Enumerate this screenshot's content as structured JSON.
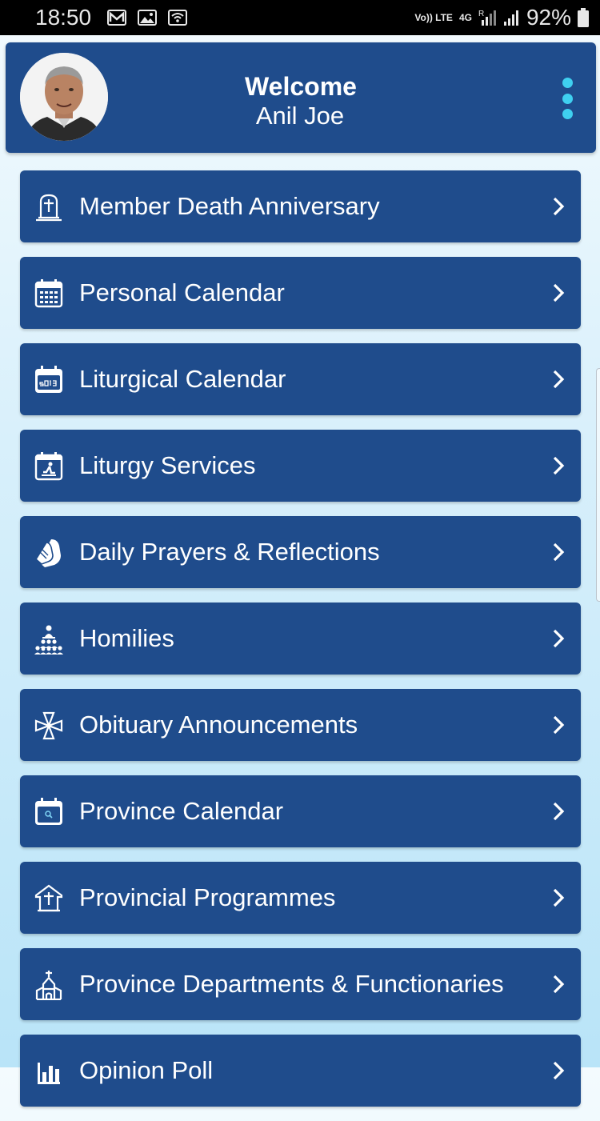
{
  "status_bar": {
    "time": "18:50",
    "battery": "92%",
    "volte_label": "Vo)) LTE",
    "network_label": "4G",
    "roaming_label": "R"
  },
  "header": {
    "welcome": "Welcome",
    "user_name": "Anil Joe",
    "avatar": "user-avatar"
  },
  "menu": {
    "items": [
      {
        "label": "Member Death Anniversary",
        "icon": "tombstone-cross-icon"
      },
      {
        "label": "Personal Calendar",
        "icon": "calendar-grid-icon"
      },
      {
        "label": "Liturgical Calendar",
        "icon": "calendar-2013-icon"
      },
      {
        "label": "Liturgy Services",
        "icon": "calendar-prayer-icon"
      },
      {
        "label": "Daily Prayers & Reflections",
        "icon": "praying-hands-icon"
      },
      {
        "label": "Homilies",
        "icon": "congregation-icon"
      },
      {
        "label": "Obituary Announcements",
        "icon": "maltese-cross-icon"
      },
      {
        "label": "Province Calendar",
        "icon": "calendar-search-icon"
      },
      {
        "label": "Provincial Programmes",
        "icon": "chapel-cross-icon"
      },
      {
        "label": "Province Departments & Functionaries",
        "icon": "church-building-icon"
      },
      {
        "label": "Opinion Poll",
        "icon": "bar-chart-icon"
      }
    ]
  },
  "colors": {
    "primary": "#1f4c8c",
    "accent": "#3fd0f0",
    "background": "#d9f0fb"
  }
}
